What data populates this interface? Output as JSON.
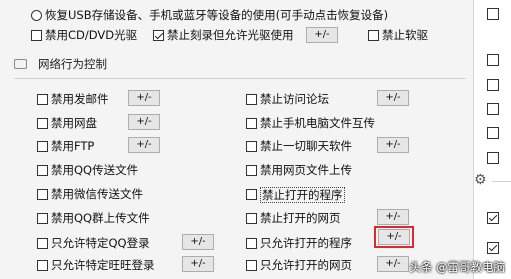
{
  "top": {
    "restore_usb_label": "恢复USB存储设备、手机或蓝牙等设备的使用(可手动点击恢复设备)",
    "disable_cddvd_label": "禁用CD/DVD光驱",
    "disable_burn_label": "禁止刻录但允许光驱使用",
    "disable_floppy_label": "禁止软驱",
    "adjust_label": "+/-"
  },
  "network_section": {
    "title": "网络行为控制",
    "left_items": [
      {
        "label": "禁用发邮件",
        "checked": false,
        "has_button": true
      },
      {
        "label": "禁用网盘",
        "checked": false,
        "has_button": true
      },
      {
        "label": "禁用FTP",
        "checked": false,
        "has_button": true
      },
      {
        "label": "禁用QQ传送文件",
        "checked": false,
        "has_button": false
      },
      {
        "label": "禁用微信传送文件",
        "checked": false,
        "has_button": false
      },
      {
        "label": "禁用QQ群上传文件",
        "checked": false,
        "has_button": false
      },
      {
        "label": "只允许特定QQ登录",
        "checked": false,
        "has_button": true
      },
      {
        "label": "只允许特定旺旺登录",
        "checked": false,
        "has_button": true
      }
    ],
    "right_items": [
      {
        "label": "禁止访问论坛",
        "checked": false,
        "has_button": true
      },
      {
        "label": "禁止手机电脑文件互传",
        "checked": false,
        "has_button": false
      },
      {
        "label": "禁止一切聊天软件",
        "checked": false,
        "has_button": true
      },
      {
        "label": "禁用网页文件上传",
        "checked": false,
        "has_button": false
      },
      {
        "label": "禁止打开的程序",
        "checked": false,
        "has_button": false
      },
      {
        "label": "禁止打开的网页",
        "checked": false,
        "has_button": true
      },
      {
        "label": "只允许打开的程序",
        "checked": false,
        "has_button": true
      },
      {
        "label": "只允许打开的网页",
        "checked": false,
        "has_button": true
      }
    ],
    "button_label": "+/-"
  },
  "right_strip": {
    "checkboxes_checked": [
      false,
      false,
      false,
      false,
      false,
      false,
      false,
      true,
      true
    ]
  },
  "watermark": "头条 @雷哥教电脑",
  "colors": {
    "panel_bg": "#f4f4f4",
    "highlight_border": "#e0282c"
  }
}
